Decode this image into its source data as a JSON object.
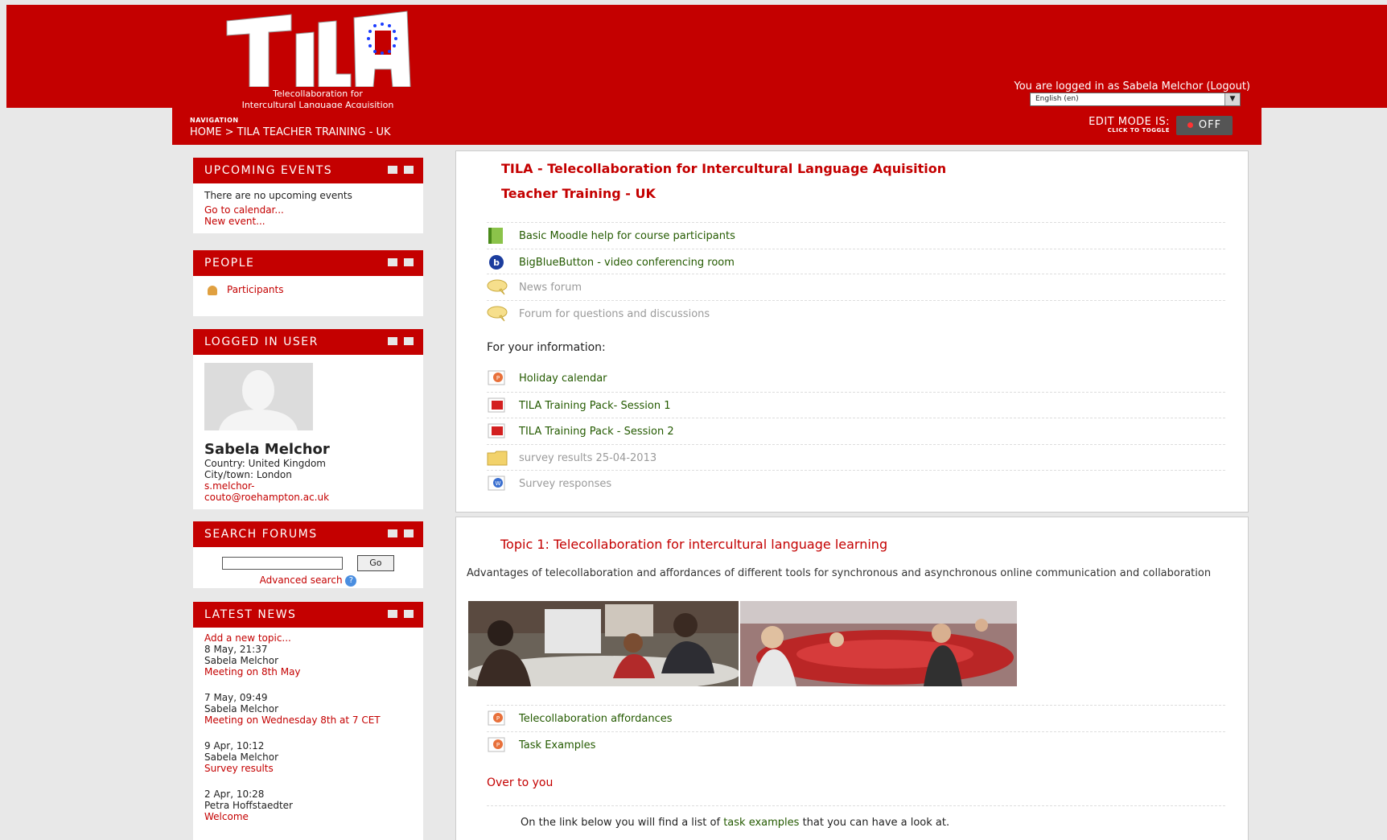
{
  "header": {
    "logo_line1": "Telecollaboration for",
    "logo_line2": "Intercultural Language Acquisition",
    "login_prefix": "You are logged in as",
    "user_name": "Sabela Melchor",
    "logout": "(Logout)",
    "language": "English (en)",
    "brand_color": "#c40000"
  },
  "nav": {
    "label": "NAVIGATION",
    "home": "HOME",
    "separator": ">",
    "course": "TILA TEACHER TRAINING - UK",
    "edit_mode_label": "EDIT MODE IS:",
    "edit_mode_hint": "CLICK TO TOGGLE",
    "edit_mode_state": "OFF"
  },
  "sidebar": {
    "upcoming": {
      "title": "UPCOMING EVENTS",
      "none": "There are no upcoming events",
      "calendar": "Go to calendar...",
      "new_event": "New event..."
    },
    "people": {
      "title": "PEOPLE",
      "participants": "Participants"
    },
    "logged_user": {
      "title": "LOGGED IN USER",
      "name": "Sabela Melchor",
      "country": "Country: United Kingdom",
      "city": "City/town: London",
      "email_1": "s.melchor-",
      "email_2": "couto@roehampton.ac.uk"
    },
    "search": {
      "title": "SEARCH FORUMS",
      "go": "Go",
      "advanced": "Advanced search"
    },
    "news": {
      "title": "LATEST NEWS",
      "add": "Add a new topic...",
      "items": [
        {
          "date": "8 May, 21:37",
          "author": "Sabela Melchor",
          "subject": "Meeting on 8th May"
        },
        {
          "date": "7 May, 09:49",
          "author": "Sabela Melchor",
          "subject": "Meeting on Wednesday 8th at 7 CET"
        },
        {
          "date": "9 Apr, 10:12",
          "author": "Sabela Melchor",
          "subject": "Survey results"
        },
        {
          "date": "2 Apr, 10:28",
          "author": "Petra Hoffstaedter",
          "subject": "Welcome"
        }
      ]
    }
  },
  "main": {
    "title": "TILA - Telecollaboration for Intercultural Language Aquisition",
    "subtitle": "Teacher Training - UK",
    "activities": [
      {
        "icon": "book-icon",
        "label": "Basic Moodle help for course participants"
      },
      {
        "icon": "bigbluebutton-icon",
        "label": "BigBlueButton - video conferencing room"
      },
      {
        "icon": "forum-icon",
        "label": "News forum"
      },
      {
        "icon": "forum-icon",
        "label": "Forum for questions and discussions"
      }
    ],
    "info_label": "For your information:",
    "resources": [
      {
        "icon": "powerpoint-icon",
        "label": "Holiday calendar"
      },
      {
        "icon": "pdf-icon",
        "label": "TILA Training Pack- Session 1"
      },
      {
        "icon": "pdf-icon",
        "label": "TILA Training Pack - Session 2"
      },
      {
        "icon": "folder-icon",
        "label": "survey results 25-04-2013"
      },
      {
        "icon": "word-icon",
        "label": "Survey responses"
      }
    ],
    "topic1": {
      "title": "Topic 1: Telecollaboration for intercultural language learning",
      "summary": "Advantages of telecollaboration and affordances of different tools for synchronous and asynchronous online communication and collaboration",
      "files": [
        "Telecollaboration affordances",
        "Task Examples"
      ],
      "over_to_you": "Over to you",
      "footer_before": "On the link below you will find a list of",
      "footer_link": "task examples",
      "footer_after": "that you can have a look at."
    }
  }
}
